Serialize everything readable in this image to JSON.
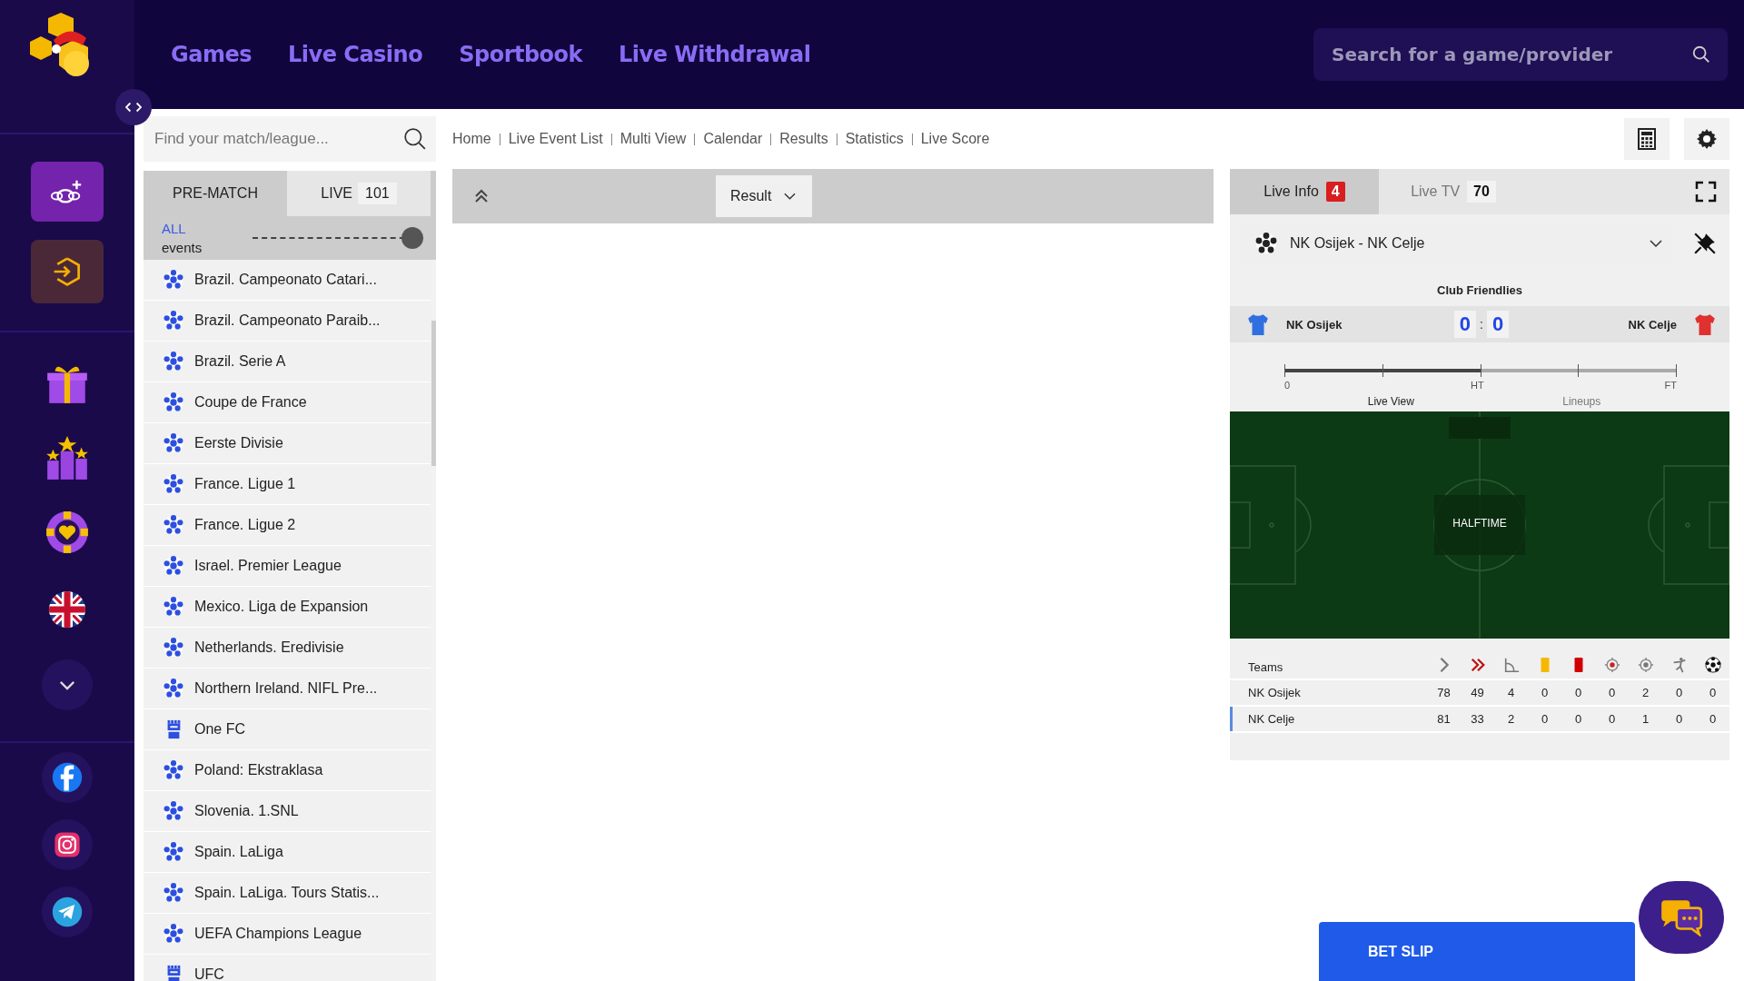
{
  "nav": [
    "Games",
    "Live Casino",
    "Sportbook",
    "Live Withdrawal"
  ],
  "site_search": {
    "placeholder": "Search for a game/provider"
  },
  "league_search": {
    "placeholder": "Find your match/league..."
  },
  "mode_tabs": [
    {
      "label": "PRE-MATCH",
      "selected": true
    },
    {
      "label": "LIVE",
      "count": "101",
      "selected": false
    }
  ],
  "events_filter": {
    "label": "ALL",
    "sublabel": "events",
    "level": 1
  },
  "leagues": [
    {
      "name": "Brazil. Campeonato Catari...",
      "kind": "football"
    },
    {
      "name": "Brazil. Campeonato Paraib...",
      "kind": "football"
    },
    {
      "name": "Brazil. Serie A",
      "kind": "football"
    },
    {
      "name": "Coupe de France",
      "kind": "football"
    },
    {
      "name": "Eerste Divisie",
      "kind": "football"
    },
    {
      "name": "France. Ligue 1",
      "kind": "football"
    },
    {
      "name": "France. Ligue 2",
      "kind": "football"
    },
    {
      "name": "Israel. Premier League",
      "kind": "football"
    },
    {
      "name": "Mexico. Liga de Expansion",
      "kind": "football"
    },
    {
      "name": "Netherlands. Eredivisie",
      "kind": "football"
    },
    {
      "name": "Northern Ireland. NIFL Pre...",
      "kind": "football"
    },
    {
      "name": "One FC",
      "kind": "combat"
    },
    {
      "name": "Poland: Ekstraklasa",
      "kind": "football"
    },
    {
      "name": "Slovenia. 1.SNL",
      "kind": "football"
    },
    {
      "name": "Spain. LaLiga",
      "kind": "football"
    },
    {
      "name": "Spain. LaLiga. Tours Statis...",
      "kind": "football"
    },
    {
      "name": "UEFA Champions League",
      "kind": "football"
    },
    {
      "name": "UFC",
      "kind": "combat"
    }
  ],
  "breadcrumbs": [
    "Home",
    "Live Event List",
    "Multi View",
    "Calendar",
    "Results",
    "Statistics",
    "Live Score"
  ],
  "market_select": {
    "value": "Result"
  },
  "live_tabs": [
    {
      "label": "Live Info",
      "count": "4",
      "selected": true
    },
    {
      "label": "Live TV",
      "count": "70",
      "selected": false
    }
  ],
  "match": {
    "title": "NK Osijek - NK Celje",
    "competition": "Club Friendlies",
    "home": {
      "name": "NK Osijek",
      "score": "0",
      "color": "#2f6fe0"
    },
    "away": {
      "name": "NK Celje",
      "score": "0",
      "color": "#e03030"
    },
    "separator": ":",
    "timeline": {
      "level": 0.5,
      "labels": [
        "0",
        "HT",
        "FT"
      ]
    },
    "views": [
      "Live View",
      "Lineups"
    ],
    "status": "HALFTIME"
  },
  "stats": {
    "header": "Teams",
    "rows": [
      {
        "team": "NK Osijek",
        "values": [
          "78",
          "49",
          "4",
          "0",
          "0",
          "0",
          "2",
          "0",
          "0"
        ],
        "selected": false
      },
      {
        "team": "NK Celje",
        "values": [
          "81",
          "33",
          "2",
          "0",
          "0",
          "0",
          "1",
          "0",
          "0"
        ],
        "selected": true
      }
    ]
  },
  "bet_slip": {
    "label": "BET SLIP"
  }
}
